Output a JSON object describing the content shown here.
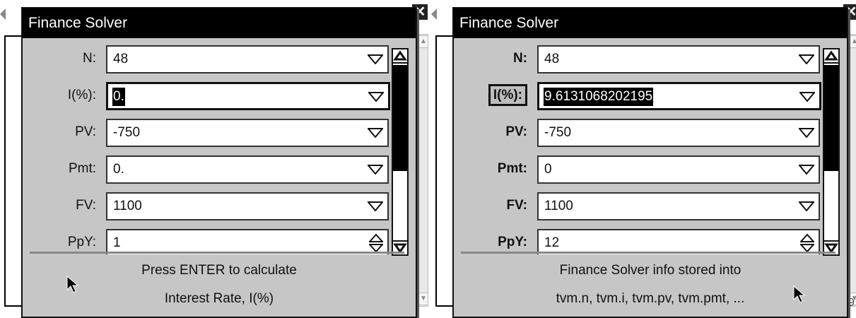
{
  "left": {
    "title": "Finance Solver",
    "rows": [
      {
        "label": "N:",
        "value": "48"
      },
      {
        "label": "I(%):",
        "value": "0."
      },
      {
        "label": "PV:",
        "value": "-750"
      },
      {
        "label": "Pmt:",
        "value": "0."
      },
      {
        "label": "FV:",
        "value": "1100"
      },
      {
        "label": "PpY:",
        "value": "1"
      }
    ],
    "message_line1": "Press ENTER to calculate",
    "message_line2": "Interest Rate, I(%)"
  },
  "right": {
    "title": "Finance Solver",
    "rows": [
      {
        "label": "N:",
        "value": "48"
      },
      {
        "label": "I(%):",
        "value": "9.6131068202195"
      },
      {
        "label": "PV:",
        "value": "-750"
      },
      {
        "label": "Pmt:",
        "value": "0"
      },
      {
        "label": "FV:",
        "value": "1100"
      },
      {
        "label": "PpY:",
        "value": "12"
      }
    ],
    "message_line1": "Finance Solver info stored into",
    "message_line2": "tvm.n, tvm.i, tvm.pv, tvm.pmt, ..."
  },
  "background_digit": "9",
  "icons": [
    "close-icon",
    "dropdown-arrow-icon",
    "spin-arrows-icon",
    "scroll-up-icon",
    "scroll-down-icon",
    "mouse-pointer-icon",
    "left-arrow-icon"
  ]
}
